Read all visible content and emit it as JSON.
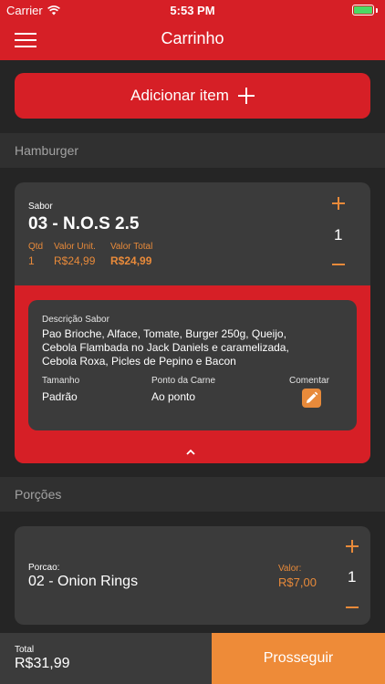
{
  "status_bar": {
    "carrier": "Carrier",
    "time": "5:53 PM"
  },
  "navbar": {
    "title": "Carrinho"
  },
  "add_item": {
    "label": "Adicionar item"
  },
  "sections": {
    "hamburger": "Hamburger",
    "porcoes": "Porções"
  },
  "burger_card": {
    "flavor_label": "Sabor",
    "flavor_name": "03 - N.O.S 2.5",
    "qty_label": "Qtd",
    "unit_value_label": "Valor Unit.",
    "total_value_label": "Valor Total",
    "qty": "1",
    "unit_value": "R$24,99",
    "total_value": "R$24,99",
    "stepper_qty": "1",
    "details": {
      "description_label": "Descrição Sabor",
      "description_lines": [
        "Pao Brioche, Alface, Tomate, Burger 250g, Queijo,",
        "Cebola Flambada no Jack Daniels e caramelizada,",
        "Cebola Roxa, Picles de Pepino e Bacon"
      ],
      "size_label": "Tamanho",
      "size_value": "Padrão",
      "doneness_label": "Ponto da Carne",
      "doneness_value": "Ao ponto",
      "comment_label": "Comentar"
    }
  },
  "portion_card": {
    "label": "Porcao:",
    "name": "02 - Onion Rings",
    "value_label": "Valor:",
    "value": "R$7,00",
    "stepper_qty": "1"
  },
  "footer": {
    "total_label": "Total",
    "total_value": "R$31,99",
    "proceed_label": "Prosseguir"
  },
  "colors": {
    "brand_red": "#d61f26",
    "accent_orange": "#ee8b38",
    "background": "#252525",
    "card": "#3b3b3b"
  }
}
